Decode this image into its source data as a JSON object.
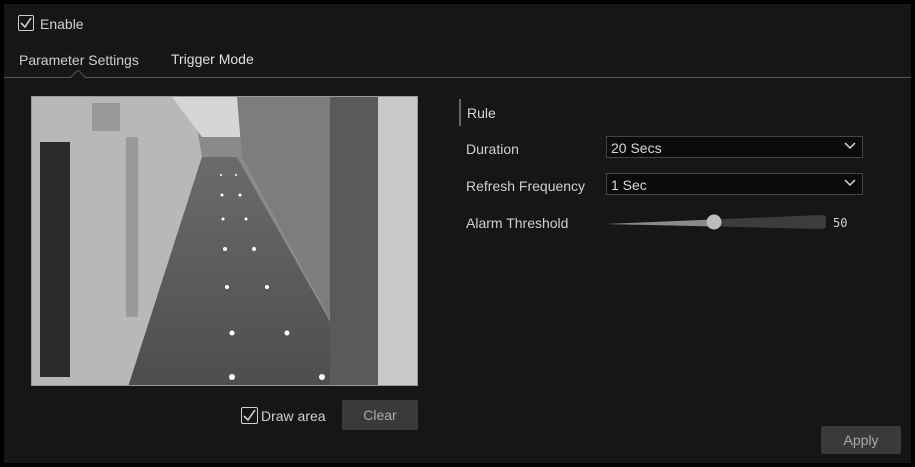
{
  "enable": {
    "label": "Enable",
    "checked": true
  },
  "tabs": [
    {
      "label": "Parameter Settings",
      "active": true
    },
    {
      "label": "Trigger Mode",
      "active": false
    }
  ],
  "rule": {
    "title": "Rule"
  },
  "fields": {
    "duration": {
      "label": "Duration",
      "value": "20 Secs"
    },
    "refresh": {
      "label": "Refresh Frequency",
      "value": "1 Sec"
    },
    "threshold": {
      "label": "Alarm Threshold",
      "value": "50",
      "level_percent": 50
    }
  },
  "draw_area": {
    "label": "Draw area",
    "checked": true
  },
  "buttons": {
    "clear": "Clear",
    "apply": "Apply"
  },
  "icons": [
    "checkbox-checked-icon",
    "chevron-down-icon"
  ]
}
